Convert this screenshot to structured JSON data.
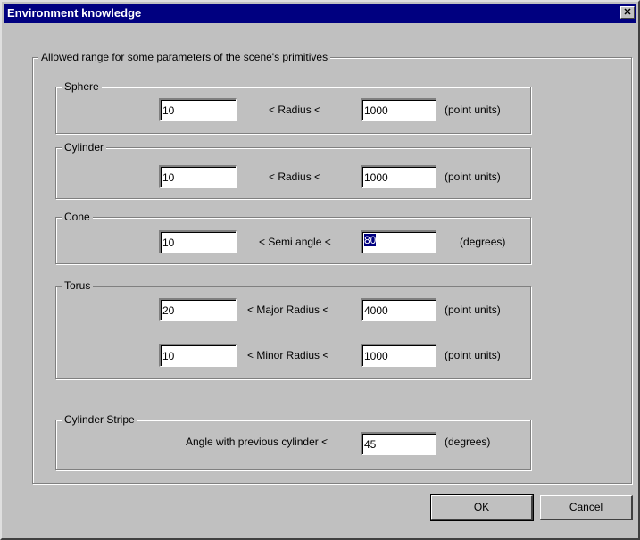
{
  "window": {
    "title": "Environment knowledge",
    "close_glyph": "✕"
  },
  "main_group": {
    "legend": "Allowed range for some parameters of the scene's primitives"
  },
  "sphere": {
    "legend": "Sphere",
    "min": "10",
    "label": "< Radius <",
    "max": "1000",
    "unit": "(point units)"
  },
  "cylinder": {
    "legend": "Cylinder",
    "min": "10",
    "label": "< Radius <",
    "max": "1000",
    "unit": "(point units)"
  },
  "cone": {
    "legend": "Cone",
    "min": "10",
    "label": "< Semi angle <",
    "max": "80",
    "unit": "(degrees)"
  },
  "torus": {
    "legend": "Torus",
    "major_min": "20",
    "major_label": "< Major Radius <",
    "major_max": "4000",
    "major_unit": "(point units)",
    "minor_min": "10",
    "minor_label": "< Minor Radius <",
    "minor_max": "1000",
    "minor_unit": "(point units)"
  },
  "stripe": {
    "legend": "Cylinder Stripe",
    "label": "Angle with previous cylinder <",
    "value": "45",
    "unit": "(degrees)"
  },
  "buttons": {
    "ok": "OK",
    "cancel": "Cancel"
  },
  "colors": {
    "titlebar": "#000080",
    "face": "#c0c0c0",
    "selection": "#000080"
  }
}
